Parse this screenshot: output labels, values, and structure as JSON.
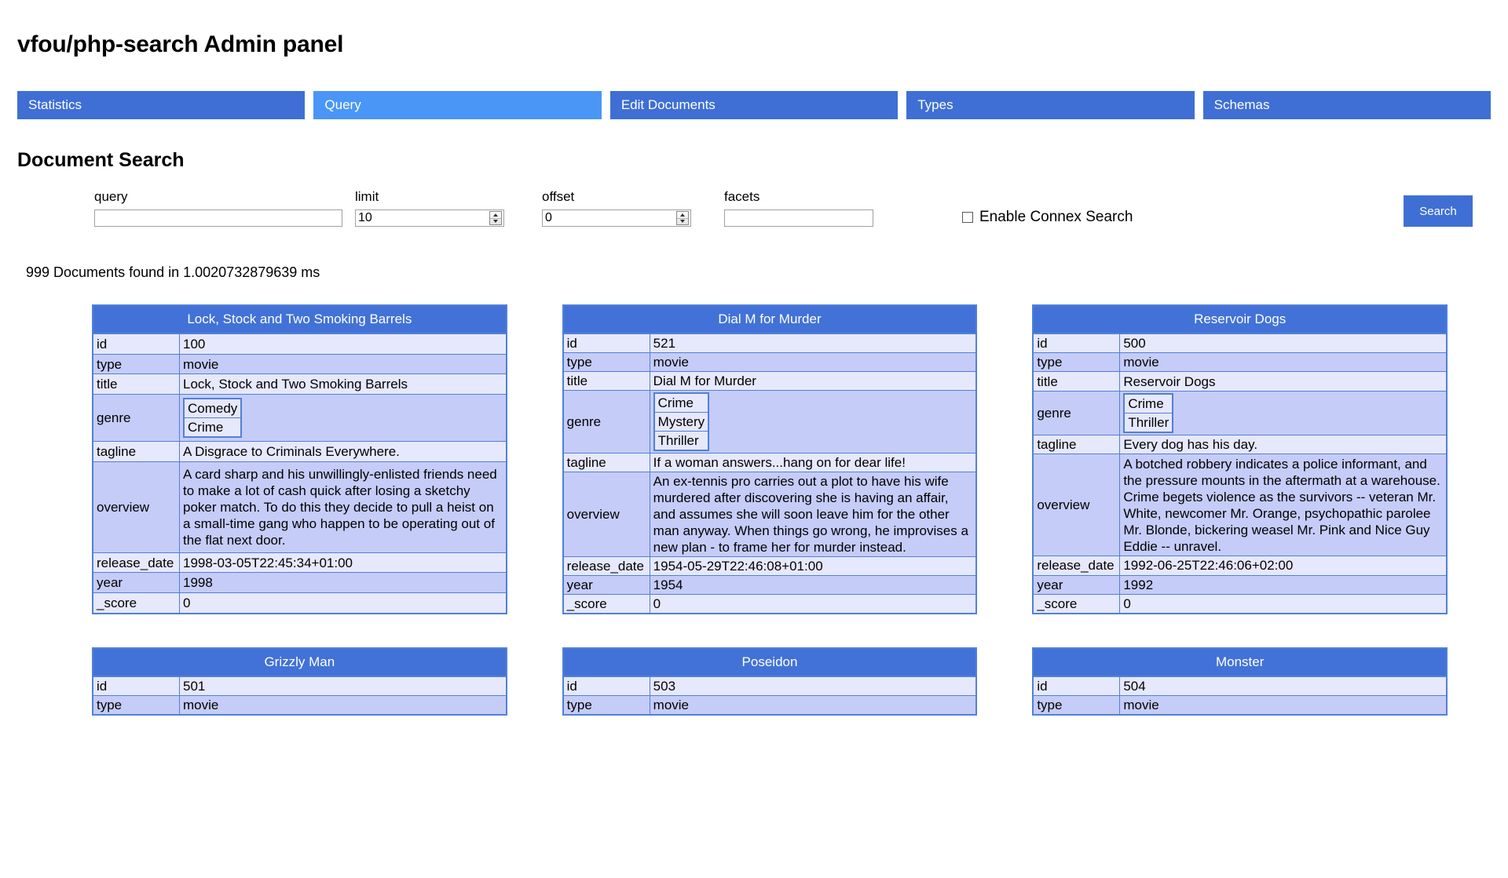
{
  "header": {
    "title": "vfou/php-search Admin panel"
  },
  "tabs": [
    {
      "label": "Statistics",
      "active": false
    },
    {
      "label": "Query",
      "active": true
    },
    {
      "label": "Edit Documents",
      "active": false
    },
    {
      "label": "Types",
      "active": false
    },
    {
      "label": "Schemas",
      "active": false
    }
  ],
  "colors": {
    "tab": "#3f6fd4",
    "tab_active": "#4a96f7",
    "card_header": "#4272d7",
    "row_light": "#e6e8fb",
    "row_dark": "#c5ccf7",
    "border": "#5180d8",
    "button": "#3f6fd4"
  },
  "search": {
    "section_title": "Document Search",
    "fields": {
      "query": {
        "label": "query",
        "value": "",
        "placeholder": ""
      },
      "limit": {
        "label": "limit",
        "value": "10"
      },
      "offset": {
        "label": "offset",
        "value": "0"
      },
      "facets": {
        "label": "facets",
        "value": "",
        "placeholder": ""
      }
    },
    "connex": {
      "label": "Enable Connex Search",
      "checked": false
    },
    "submit_label": "Search",
    "result_count_text": "999 Documents found in 1.0020732879639 ms"
  },
  "results": [
    {
      "title": "Lock, Stock and Two Smoking Barrels",
      "rows": [
        {
          "key": "id",
          "value": "100"
        },
        {
          "key": "type",
          "value": "movie"
        },
        {
          "key": "title",
          "value": "Lock, Stock and Two Smoking Barrels"
        },
        {
          "key": "genre",
          "list": [
            "Comedy",
            "Crime"
          ]
        },
        {
          "key": "tagline",
          "value": "A Disgrace to Criminals Everywhere."
        },
        {
          "key": "overview",
          "value": "A card sharp and his unwillingly-enlisted friends need to make a lot of cash quick after losing a sketchy poker match. To do this they decide to pull a heist on a small-time gang who happen to be operating out of the flat next door."
        },
        {
          "key": "release_date",
          "value": "1998-03-05T22:45:34+01:00"
        },
        {
          "key": "year",
          "value": "1998"
        },
        {
          "key": "_score",
          "value": "0"
        }
      ]
    },
    {
      "title": "Dial M for Murder",
      "rows": [
        {
          "key": "id",
          "value": "521"
        },
        {
          "key": "type",
          "value": "movie"
        },
        {
          "key": "title",
          "value": "Dial M for Murder"
        },
        {
          "key": "genre",
          "list": [
            "Crime",
            "Mystery",
            "Thriller"
          ]
        },
        {
          "key": "tagline",
          "value": "If a woman answers...hang on for dear life!"
        },
        {
          "key": "overview",
          "value": "An ex-tennis pro carries out a plot to have his wife murdered after discovering she is having an affair, and assumes she will soon leave him for the other man anyway. When things go wrong, he improvises a new plan - to frame her for murder instead."
        },
        {
          "key": "release_date",
          "value": "1954-05-29T22:46:08+01:00"
        },
        {
          "key": "year",
          "value": "1954"
        },
        {
          "key": "_score",
          "value": "0"
        }
      ]
    },
    {
      "title": "Reservoir Dogs",
      "rows": [
        {
          "key": "id",
          "value": "500"
        },
        {
          "key": "type",
          "value": "movie"
        },
        {
          "key": "title",
          "value": "Reservoir Dogs"
        },
        {
          "key": "genre",
          "list": [
            "Crime",
            "Thriller"
          ]
        },
        {
          "key": "tagline",
          "value": "Every dog has his day."
        },
        {
          "key": "overview",
          "value": "A botched robbery indicates a police informant, and the pressure mounts in the aftermath at a warehouse. Crime begets violence as the survivors -- veteran Mr. White, newcomer Mr. Orange, psychopathic parolee Mr. Blonde, bickering weasel Mr. Pink and Nice Guy Eddie -- unravel."
        },
        {
          "key": "release_date",
          "value": "1992-06-25T22:46:06+02:00"
        },
        {
          "key": "year",
          "value": "1992"
        },
        {
          "key": "_score",
          "value": "0"
        }
      ]
    },
    {
      "title": "Grizzly Man",
      "rows": [
        {
          "key": "id",
          "value": "501"
        },
        {
          "key": "type",
          "value": "movie"
        }
      ]
    },
    {
      "title": "Poseidon",
      "rows": [
        {
          "key": "id",
          "value": "503"
        },
        {
          "key": "type",
          "value": "movie"
        }
      ]
    },
    {
      "title": "Monster",
      "rows": [
        {
          "key": "id",
          "value": "504"
        },
        {
          "key": "type",
          "value": "movie"
        }
      ]
    }
  ]
}
